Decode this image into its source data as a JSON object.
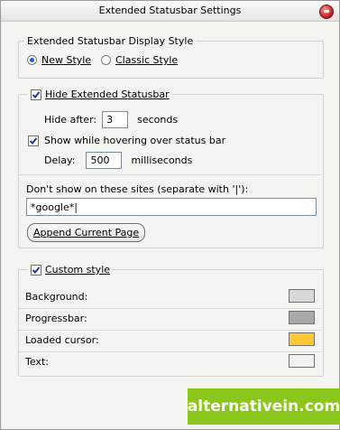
{
  "window": {
    "title": "Extended Statusbar Settings"
  },
  "display_style": {
    "legend": "Extended Statusbar Display Style",
    "options": [
      {
        "label": "New Style",
        "selected": true
      },
      {
        "label": "Classic Style",
        "selected": false
      }
    ]
  },
  "hide_group": {
    "legend": "Hide Extended Statusbar",
    "checked": true,
    "hide_after_label": "Hide after:",
    "hide_after_value": "3",
    "seconds_label": "seconds",
    "hover_label": "Show while hovering over status bar",
    "hover_checked": true,
    "delay_label": "Delay:",
    "delay_value": "500",
    "ms_label": "milliseconds",
    "sites_label": "Don't show on these sites (separate with '|'):",
    "sites_value": "*google*|",
    "append_button": "Append Current Page"
  },
  "custom_style": {
    "legend": "Custom style",
    "checked": true,
    "rows": [
      {
        "label": "Background:",
        "color": "#d8d8d8"
      },
      {
        "label": "Progressbar:",
        "color": "#a9a9a9"
      },
      {
        "label": "Loaded cursor:",
        "color": "#ffc638"
      },
      {
        "label": "Text:",
        "color": "#f2f2f2"
      }
    ]
  },
  "watermark": {
    "text": "alternativein.com"
  }
}
